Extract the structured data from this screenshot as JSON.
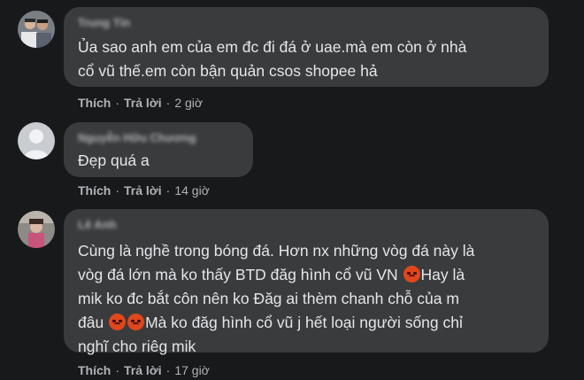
{
  "comments": [
    {
      "author": "Trung Tín",
      "text": "Ủa sao anh em của em đc đi đá ở uae.mà em còn ở nhà\ncổ vũ thế.em còn bận quản csos shopee hả",
      "like_label": "Thích",
      "reply_label": "Trả lời",
      "time": "2 giờ"
    },
    {
      "author": "Nguyễn Hữu Chương",
      "text": "Đẹp quá a",
      "like_label": "Thích",
      "reply_label": "Trả lời",
      "time": "14 giờ"
    },
    {
      "author": "Lê Anh",
      "text_parts": [
        "Cùng là nghề trong bóng đá. Hơn nx những vòg đá này là\nvòg đá lớn mà ko thấy BTD đăg hình cổ vũ VN ",
        "Hay là\nmik ko đc bắt côn nên ko Đăg ai thèm chanh chỗ của m\nđâu ",
        "Mà ko đăg hình cổ vũ j hết loại người sống chỉ\nnghĩ cho riêg mik"
      ],
      "emoji": "angry-face-icon",
      "like_label": "Thích",
      "reply_label": "Trả lời",
      "time": "17 giờ"
    }
  ],
  "dot": "·",
  "colors": {
    "background": "#18191a",
    "bubble": "#3a3b3c",
    "text": "#e4e6eb",
    "secondary": "#b0b3b8",
    "emoji": "#e0471c"
  }
}
